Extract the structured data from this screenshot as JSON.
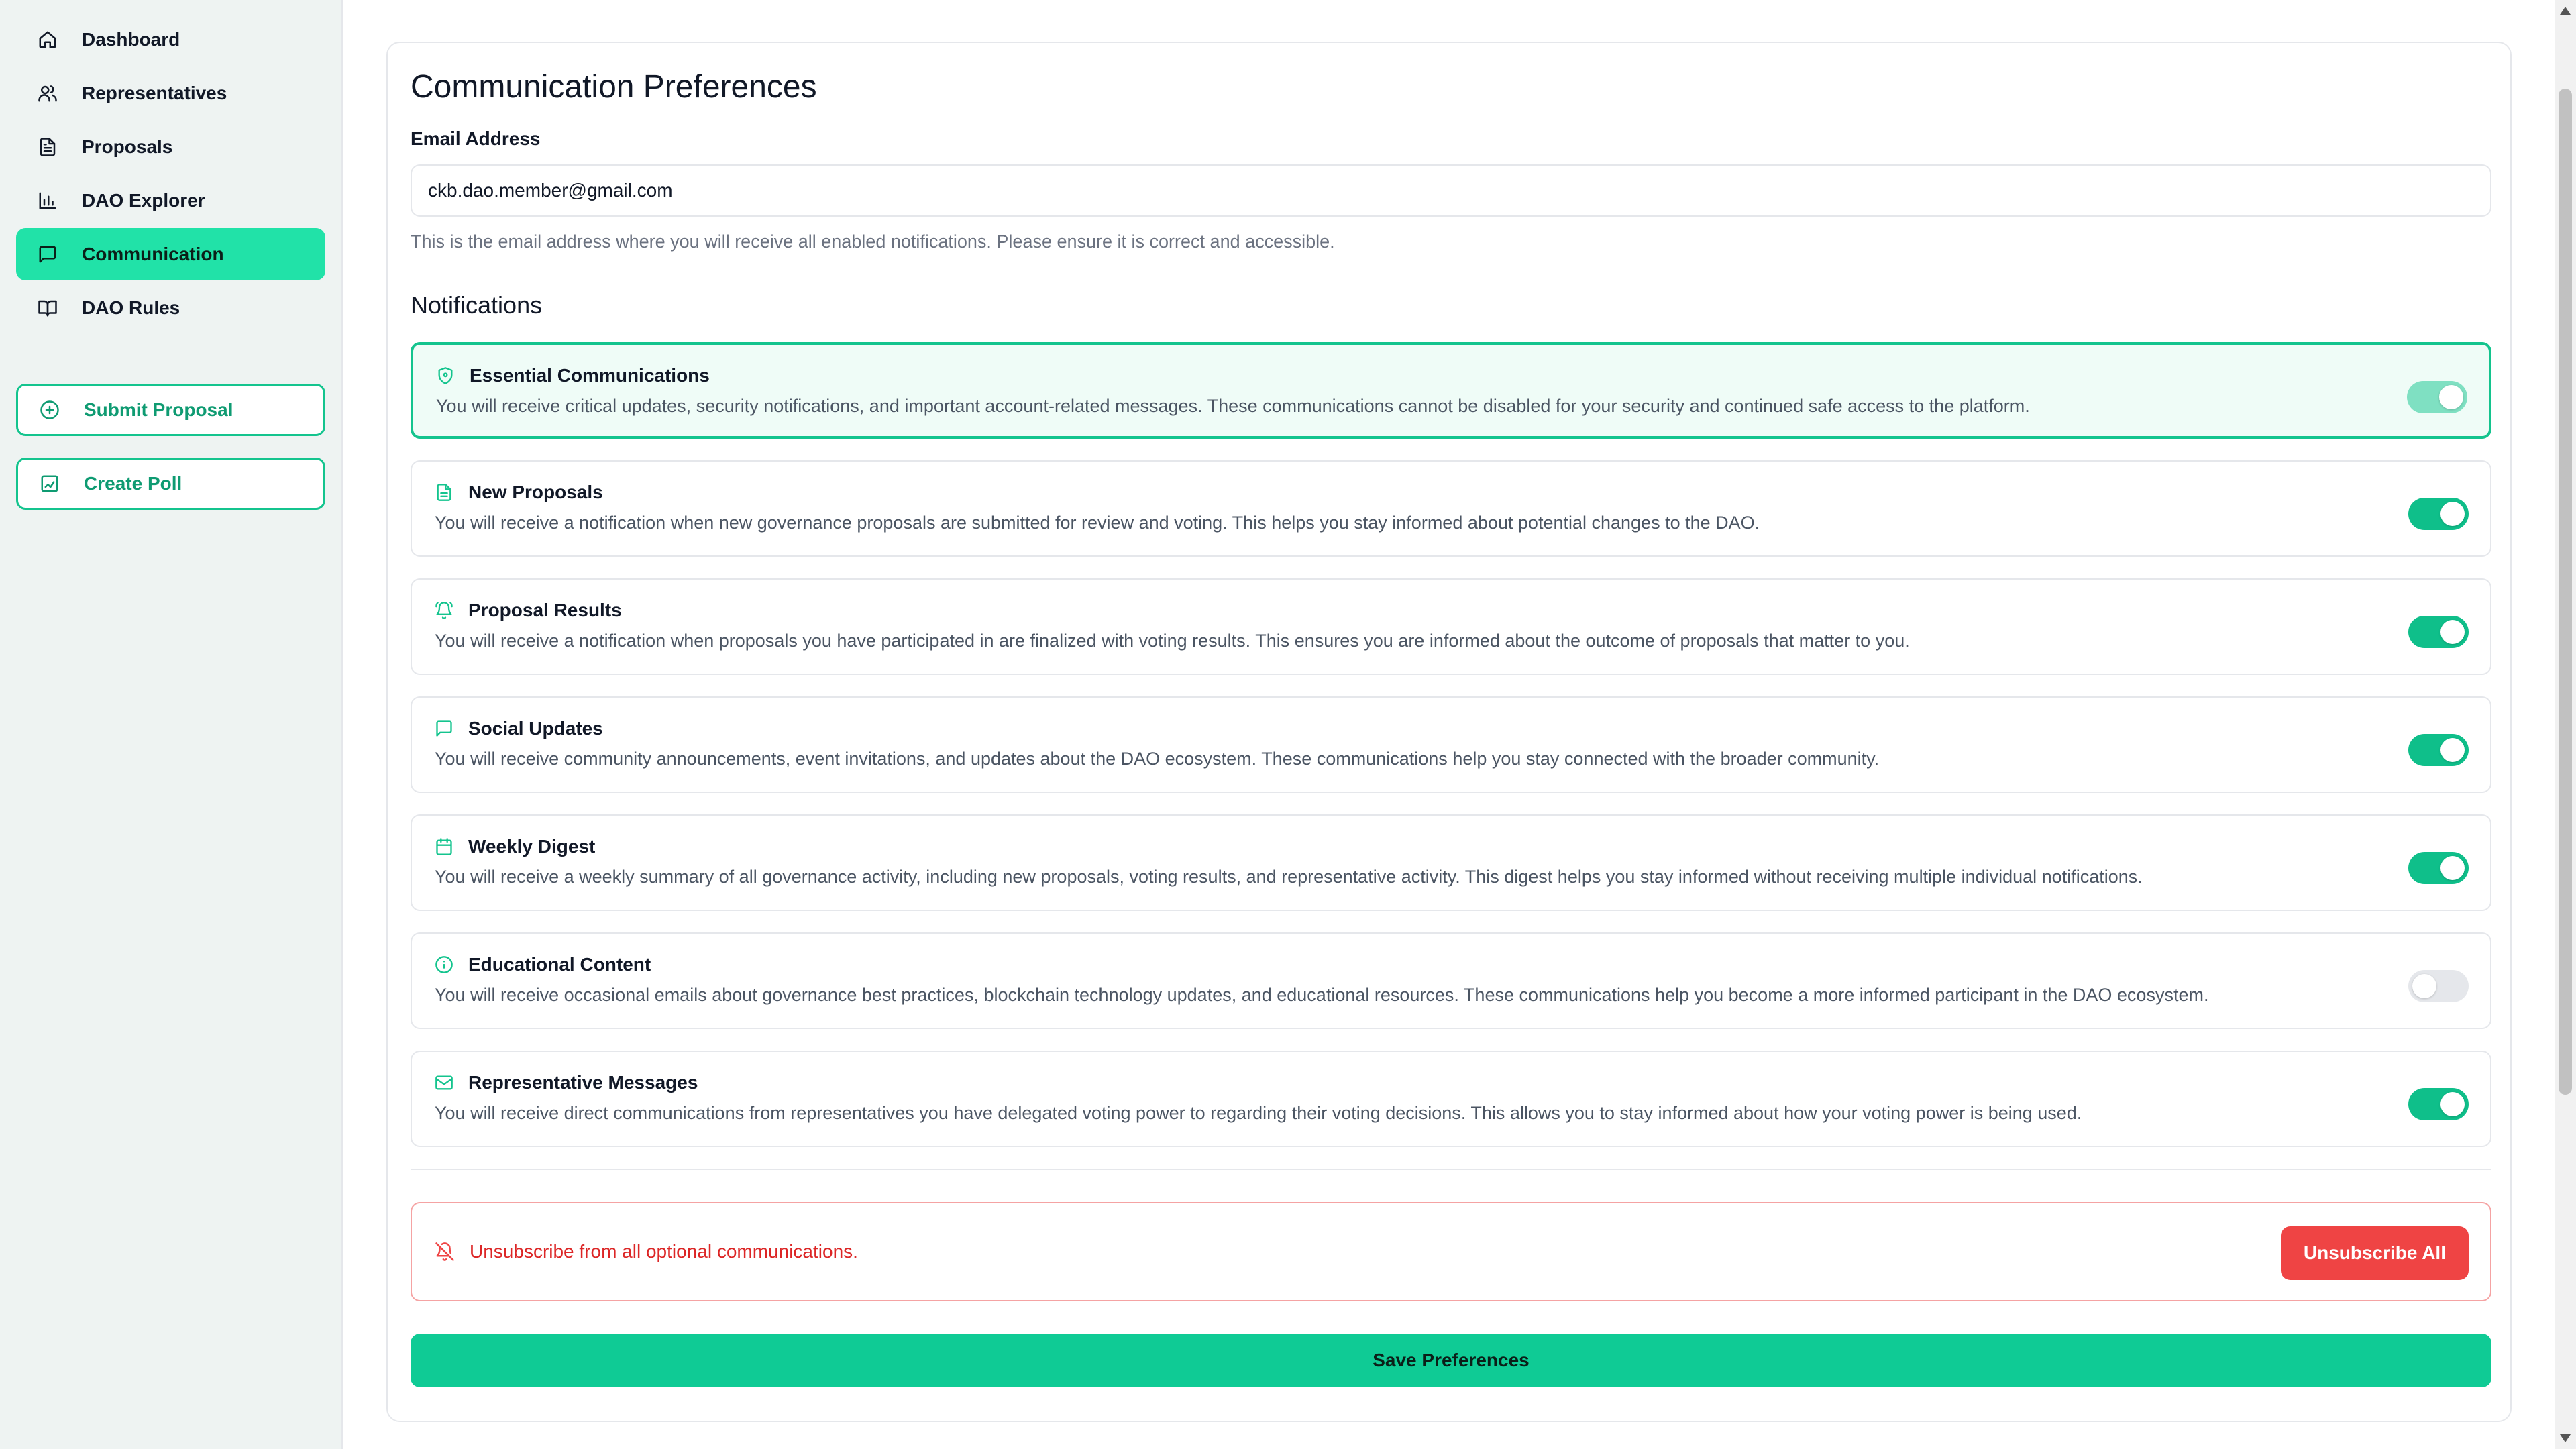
{
  "sidebar": {
    "nav": [
      {
        "label": "Dashboard",
        "icon": "home-icon"
      },
      {
        "label": "Representatives",
        "icon": "users-icon"
      },
      {
        "label": "Proposals",
        "icon": "file-text-icon"
      },
      {
        "label": "DAO Explorer",
        "icon": "bar-chart-icon"
      },
      {
        "label": "Communication",
        "icon": "message-square-icon",
        "active": true
      },
      {
        "label": "DAO Rules",
        "icon": "book-open-icon"
      }
    ],
    "submit_proposal": "Submit Proposal",
    "create_poll": "Create Poll"
  },
  "main": {
    "title": "Communication Preferences",
    "email_label": "Email Address",
    "email_value": "ckb.dao.member@gmail.com",
    "email_helper": "This is the email address where you will receive all enabled notifications. Please ensure it is correct and accessible.",
    "notifications_title": "Notifications",
    "notifications": [
      {
        "title": "Essential Communications",
        "icon": "shield-icon",
        "enabled": true,
        "locked": true,
        "description": "You will receive critical updates, security notifications, and important account-related messages. These communications cannot be disabled for your security and continued safe access to the platform."
      },
      {
        "title": "New Proposals",
        "icon": "file-text-icon",
        "enabled": true,
        "description": "You will receive a notification when new governance proposals are submitted for review and voting. This helps you stay informed about potential changes to the DAO."
      },
      {
        "title": "Proposal Results",
        "icon": "bell-ring-icon",
        "enabled": true,
        "description": "You will receive a notification when proposals you have participated in are finalized with voting results. This ensures you are informed about the outcome of proposals that matter to you."
      },
      {
        "title": "Social Updates",
        "icon": "message-square-icon",
        "enabled": true,
        "description": "You will receive community announcements, event invitations, and updates about the DAO ecosystem. These communications help you stay connected with the broader community."
      },
      {
        "title": "Weekly Digest",
        "icon": "calendar-icon",
        "enabled": true,
        "description": "You will receive a weekly summary of all governance activity, including new proposals, voting results, and representative activity. This digest helps you stay informed without receiving multiple individual notifications."
      },
      {
        "title": "Educational Content",
        "icon": "info-icon",
        "enabled": false,
        "description": "You will receive occasional emails about governance best practices, blockchain technology updates, and educational resources. These communications help you become a more informed participant in the DAO ecosystem."
      },
      {
        "title": "Representative Messages",
        "icon": "mail-icon",
        "enabled": true,
        "description": "You will receive direct communications from representatives you have delegated voting power to regarding their voting decisions. This allows you to stay informed about how your voting power is being used."
      }
    ],
    "unsubscribe_text": "Unsubscribe from all optional communications.",
    "unsubscribe_button": "Unsubscribe All",
    "save_button": "Save Preferences"
  },
  "colors": {
    "accent": "#14c48e",
    "active_nav": "#21e2a8",
    "danger": "#ef4444"
  }
}
